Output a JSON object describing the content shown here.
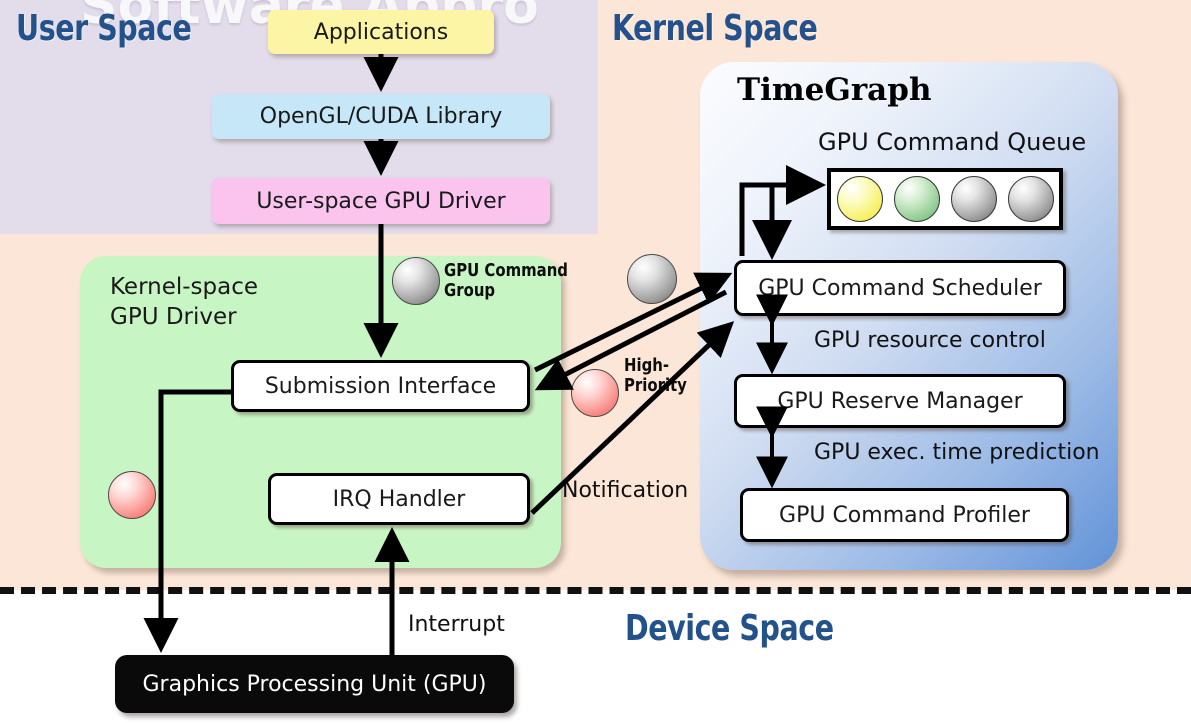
{
  "watermark": {
    "text": "Software Appro"
  },
  "sections": {
    "user": {
      "title": "User Space",
      "bg": "#e3dcea"
    },
    "kernel": {
      "title": "Kernel Space",
      "bg": "#fce6d7"
    },
    "device": {
      "title": "Device Space",
      "bg": "#ffffff"
    },
    "title_color": "#23518c"
  },
  "user_stack": [
    {
      "label": "Applications",
      "color": "#fbf5a5"
    },
    {
      "label": "OpenGL/CUDA Library",
      "color": "#c5e7f8"
    },
    {
      "label": "User-space GPU Driver",
      "color": "#fac4ee"
    }
  ],
  "kernel_driver": {
    "panel_label": "Kernel-space\nGPU Driver",
    "panel_label_line1": "Kernel-space",
    "panel_label_line2": "GPU Driver",
    "panel_color": "#c8f5c4",
    "boxes": [
      {
        "label": "Submission Interface"
      },
      {
        "label": "IRQ Handler"
      }
    ]
  },
  "timegraph": {
    "title": "TimeGraph",
    "queue_label": "GPU Command Queue",
    "queue_dots": [
      {
        "state": "yellow"
      },
      {
        "state": "green"
      },
      {
        "state": "gray"
      },
      {
        "state": "gray"
      }
    ],
    "boxes": [
      {
        "label": "GPU Command Scheduler"
      },
      {
        "label": "GPU Reserve Manager"
      },
      {
        "label": "GPU Command Profiler"
      }
    ],
    "edge_labels": [
      {
        "label": "GPU resource control"
      },
      {
        "label": "GPU exec. time prediction"
      }
    ]
  },
  "legend": [
    {
      "label": "GPU Command Group",
      "line1": "GPU Command",
      "line2": "Group",
      "state": "gray"
    },
    {
      "label": "High-Priority",
      "line1": "High-",
      "line2": "Priority",
      "state": "red"
    }
  ],
  "edges": {
    "notification": "Notification",
    "interrupt": "Interrupt"
  },
  "device": {
    "gpu_label": "Graphics Processing Unit (GPU)",
    "gpu_color": "#0a0a0a"
  }
}
